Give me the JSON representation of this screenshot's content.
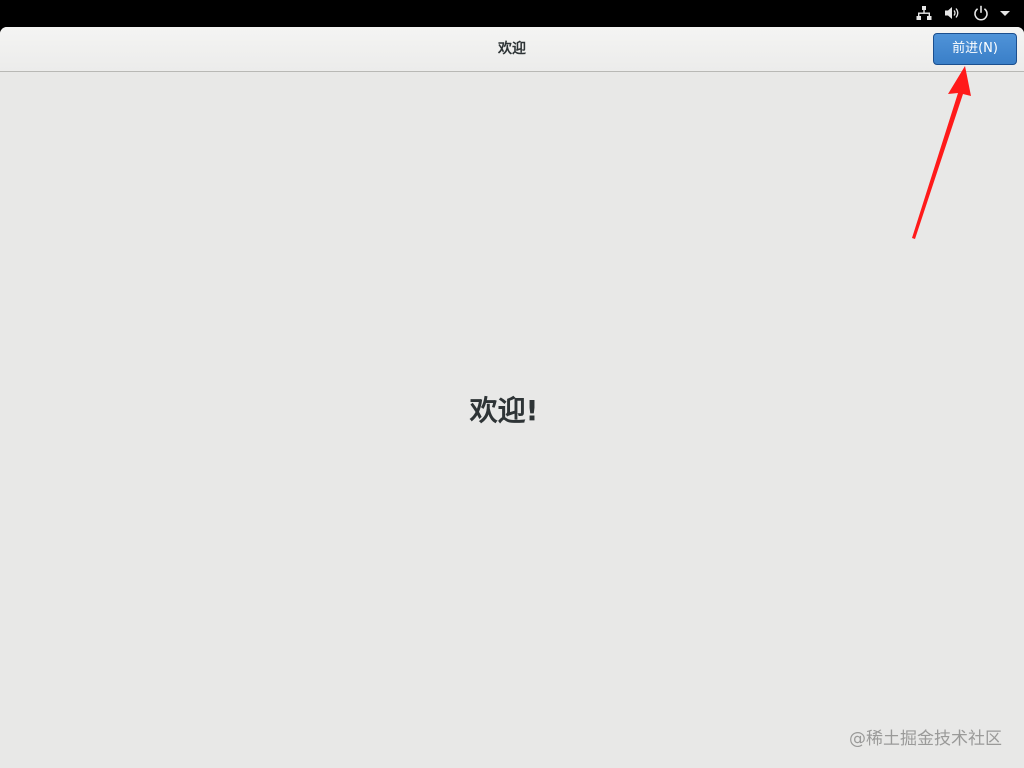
{
  "tray": {
    "icons": [
      "network-icon",
      "volume-icon",
      "power-icon",
      "menu-arrow-icon"
    ]
  },
  "header": {
    "title": "欢迎",
    "next_label": "前进(N)"
  },
  "main": {
    "welcome": "欢迎!"
  },
  "watermark": "@稀土掘金技术社区",
  "colors": {
    "accent": "#3b82cc",
    "annotation_arrow": "#ff1a1a",
    "background": "#e8e8e7"
  }
}
